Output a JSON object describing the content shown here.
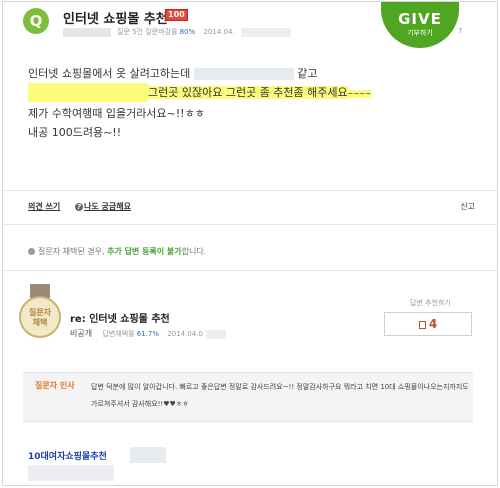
{
  "question": {
    "badge": "Q",
    "title": "인터넷 쇼핑몰 추천",
    "points": "100",
    "meta_text": "질문 5건  질문마감률",
    "meta_rate": "80%",
    "meta_date": "2014.04.",
    "meta_num": "7",
    "lines": [
      "인터넷 쇼핑몰에서 옷 살려고하는데",
      "같고",
      "그런곳 있잖아요 그런곳 좀 추천좀 해주세요",
      "~~~~",
      "제가 수학여행때 입을거라서요~!!ㅎㅎ",
      "내공 100드려용~!!"
    ]
  },
  "give": {
    "big": "GIVE",
    "small": "기부하기"
  },
  "actions": {
    "comment": "의견 쓰기",
    "me_too": "나도 궁금해요",
    "report": "신고"
  },
  "notice": {
    "text_pre": "질문자 채택된 경우,",
    "highlight": "추가 답변 등록이 불가",
    "text_post": "합니다."
  },
  "answer": {
    "medal": [
      "질문자",
      "채택"
    ],
    "title": "re: 인터넷 쇼핑몰 추천",
    "author": "비공개",
    "rate_label": "답변채택률",
    "rate": "61.7%",
    "date": "2014.04.0",
    "rec_label": "답변 추천하기",
    "rec_count": "4"
  },
  "thanks": {
    "label": "질문자 인사",
    "text": "답변 덕분에 많이 알아갑니다. 빠르고 좋은답변 정말로 감사드려요~!! 정말감사하구요 뭐라고 치면 10대 쇼핑몰이나오는지까지도 가르쳐주셔서 감사해요!!♥♥ㅎㅎ"
  },
  "link": {
    "text": "10대여자쇼핑몰추천"
  }
}
